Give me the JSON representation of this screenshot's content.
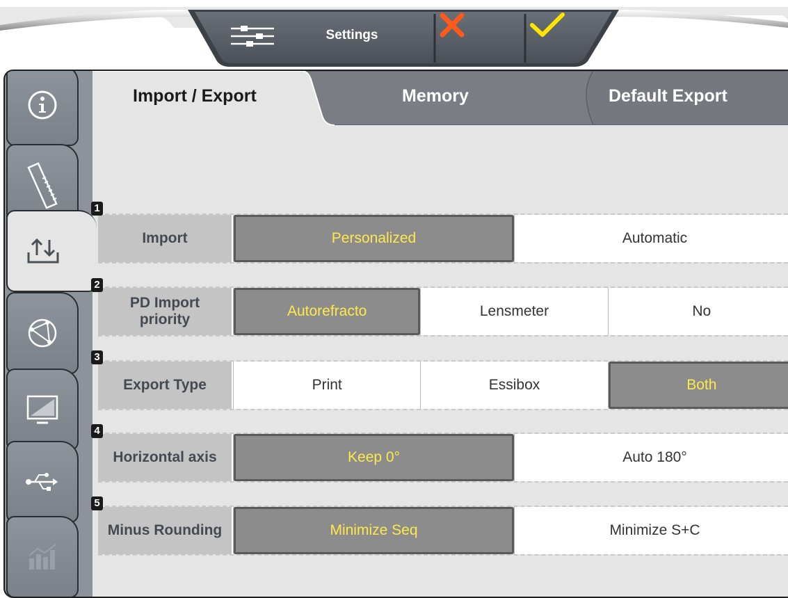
{
  "toolbar": {
    "settings_label": "Settings",
    "settings_icon": "sliders-icon",
    "cancel_icon": "close-icon",
    "confirm_icon": "check-icon",
    "cancel_color": "#ff5a1a",
    "confirm_color": "#ffe400"
  },
  "sidebar": {
    "items": [
      {
        "name": "info",
        "icon": "info-icon",
        "active": false
      },
      {
        "name": "ruler",
        "icon": "ruler-icon",
        "active": false
      },
      {
        "name": "import-export",
        "icon": "import-export-icon",
        "active": true
      },
      {
        "name": "network",
        "icon": "network-icon",
        "active": false
      },
      {
        "name": "display",
        "icon": "monitor-icon",
        "active": false
      },
      {
        "name": "usb",
        "icon": "usb-icon",
        "active": false
      },
      {
        "name": "statistics",
        "icon": "chart-icon",
        "active": false
      }
    ]
  },
  "tabs": [
    {
      "label": "Import / Export",
      "active": true
    },
    {
      "label": "Memory",
      "active": false
    },
    {
      "label": "Default Export",
      "active": false
    }
  ],
  "settings": [
    {
      "number": "1",
      "label": "Import",
      "options": [
        "Personalized",
        "Automatic"
      ],
      "selected": "Personalized"
    },
    {
      "number": "2",
      "label": "PD Import priority",
      "options": [
        "Autorefracto",
        "Lensmeter",
        "No"
      ],
      "selected": "Autorefracto"
    },
    {
      "number": "3",
      "label": "Export Type",
      "options": [
        "Print",
        "Essibox",
        "Both"
      ],
      "selected": "Both"
    },
    {
      "number": "4",
      "label": "Horizontal axis",
      "options": [
        "Keep 0°",
        "Auto 180°"
      ],
      "selected": "Keep 0°"
    },
    {
      "number": "5",
      "label": "Minus Rounding",
      "options": [
        "Minimize Seq",
        "Minimize S+C"
      ],
      "selected": "Minimize Seq"
    }
  ],
  "colors": {
    "selected_bg": "#8c8c8c",
    "selected_text": "#ffe94a",
    "panel_bg": "#e5e5e5",
    "toolbar_bg": "#5b6068"
  }
}
